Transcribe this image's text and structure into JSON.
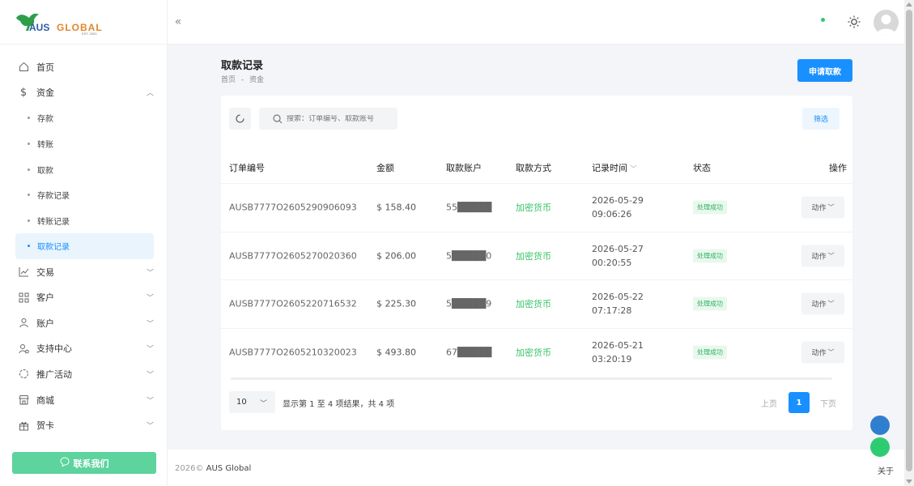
{
  "brand": {
    "name_prefix": "AUS",
    "name_suffix": "GLOBAL",
    "tagline": "EST. 2003"
  },
  "sidebar": {
    "items": [
      {
        "label": "首页",
        "icon": "home-icon"
      },
      {
        "label": "资金",
        "icon": "dollar-icon",
        "expanded": true
      },
      {
        "label": "交易",
        "icon": "chart-icon"
      },
      {
        "label": "客户",
        "icon": "grid-icon"
      },
      {
        "label": "账户",
        "icon": "user-icon"
      },
      {
        "label": "支持中心",
        "icon": "support-icon"
      },
      {
        "label": "推广活动",
        "icon": "promo-icon"
      },
      {
        "label": "商城",
        "icon": "shop-icon"
      },
      {
        "label": "贺卡",
        "icon": "gift-icon"
      }
    ],
    "funds_submenu": [
      {
        "label": "存款"
      },
      {
        "label": "转账"
      },
      {
        "label": "取款"
      },
      {
        "label": "存款记录"
      },
      {
        "label": "转账记录"
      },
      {
        "label": "取款记录",
        "active": true
      }
    ],
    "contact_label": "联系我们"
  },
  "page": {
    "title": "取款记录",
    "breadcrumb_home": "首页",
    "breadcrumb_sep": "-",
    "breadcrumb_current": "资金",
    "apply_button": "申请取款"
  },
  "toolbar": {
    "search_placeholder": "搜索：订单编号、取款账号",
    "filter_label": "筛选"
  },
  "table": {
    "headers": {
      "order_no": "订单编号",
      "amount": "金额",
      "account": "取款账户",
      "method": "取款方式",
      "time": "记录时间",
      "status": "状态",
      "action": "操作"
    },
    "rows": [
      {
        "order_no": "AUSB7777O2605290906093",
        "amount": "$ 158.40",
        "account": "55█████",
        "method": "加密货币",
        "date": "2026-05-29",
        "clock": "09:06:26",
        "status": "处理成功",
        "action": "动作"
      },
      {
        "order_no": "AUSB7777O2605270020360",
        "amount": "$ 206.00",
        "account": "5█████0",
        "method": "加密货币",
        "date": "2026-05-27",
        "clock": "00:20:55",
        "status": "处理成功",
        "action": "动作"
      },
      {
        "order_no": "AUSB7777O2605220716532",
        "amount": "$ 225.30",
        "account": "5█████9",
        "method": "加密货币",
        "date": "2026-05-22",
        "clock": "07:17:28",
        "status": "处理成功",
        "action": "动作"
      },
      {
        "order_no": "AUSB7777O2605210320023",
        "amount": "$ 493.80",
        "account": "67█████",
        "method": "加密货币",
        "date": "2026-05-21",
        "clock": "03:20:19",
        "status": "处理成功",
        "action": "动作"
      }
    ]
  },
  "pagination": {
    "page_size": "10",
    "info": "显示第 1 至 4 项结果，共 4 项",
    "prev": "上页",
    "current": "1",
    "next": "下页"
  },
  "footer": {
    "year": "2026©",
    "company": "AUS Global",
    "about": "关于"
  },
  "colors": {
    "primary": "#1890ff",
    "success": "#39c567",
    "contact": "#5dd39e"
  }
}
